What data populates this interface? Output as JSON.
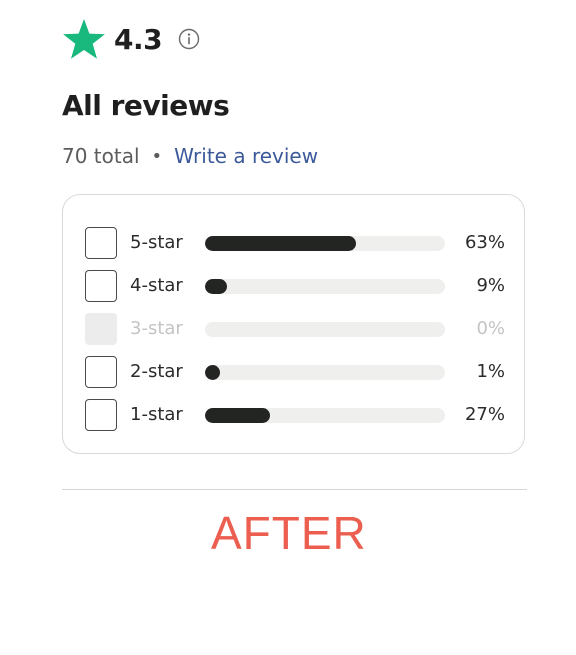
{
  "rating": {
    "value": "4.3",
    "star_icon": "star-icon",
    "star_color": "#19b87c",
    "info_icon": "info-icon"
  },
  "reviews": {
    "heading": "All reviews",
    "total_text": "70 total",
    "separator": "•",
    "write_review_link": "Write a review"
  },
  "filters": [
    {
      "label": "5-star",
      "percent_text": "63%",
      "fraction": 0.63,
      "disabled": false
    },
    {
      "label": "4-star",
      "percent_text": "9%",
      "fraction": 0.09,
      "disabled": false
    },
    {
      "label": "3-star",
      "percent_text": "0%",
      "fraction": 0.0,
      "disabled": true
    },
    {
      "label": "2-star",
      "percent_text": "1%",
      "fraction": 0.01,
      "disabled": false
    },
    {
      "label": "1-star",
      "percent_text": "27%",
      "fraction": 0.27,
      "disabled": false
    }
  ],
  "overlay_label": "AFTER",
  "colors": {
    "bar_fill": "#232522",
    "bar_track": "#efefee",
    "link": "#3c5a9a",
    "after_label": "#ec5e4f"
  }
}
